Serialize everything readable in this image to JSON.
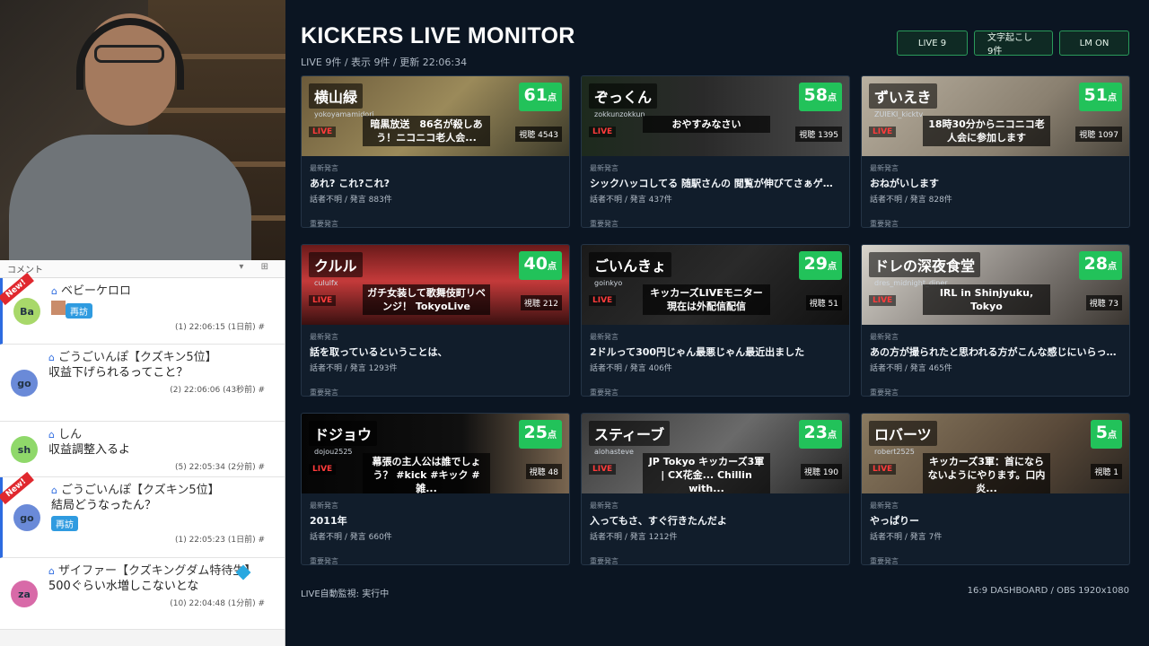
{
  "header": {
    "title": "KICKERS LIVE MONITOR",
    "subtitle": "LIVE 9件 / 表示 9件 / 更新 22:06:34",
    "buttons": {
      "live": "LIVE 9",
      "transcript": "文字起こし 9件",
      "lm": "LM ON"
    }
  },
  "labels": {
    "latest": "最新発言",
    "important": "重要発言",
    "live_badge": "LIVE",
    "score_unit": "点",
    "views_prefix": "視聴"
  },
  "cards": [
    {
      "name": "横山緑",
      "handle": "yokoyamamidori",
      "caption": "暗黒放送　86名が殺しあう！ニコニコ老人会...",
      "score": "61",
      "views": "4543",
      "latest": "あれ? これ?これ?",
      "stats": "話者不明 / 発言 883件"
    },
    {
      "name": "ぞっくん",
      "handle": "zokkunzokkun",
      "caption": "おやすみなさい",
      "score": "58",
      "views": "1395",
      "latest": "シックハッコしてる 随駅さんの 閲覧が伸びてさぁゲーム...",
      "stats": "話者不明 / 発言 437件"
    },
    {
      "name": "ずいえき",
      "handle": "ZUIEKI_kicktv",
      "caption": "18時30分からニコニコ老人会に参加します",
      "score": "51",
      "views": "1097",
      "latest": "おねがいします",
      "stats": "話者不明 / 発言 828件"
    },
    {
      "name": "クルル",
      "handle": "cululfx",
      "caption": "ガチ女装して歌舞伎町リベンジ！ TokyoLive",
      "score": "40",
      "views": "212",
      "latest": "話を取っているということは、",
      "stats": "話者不明 / 発言 1293件"
    },
    {
      "name": "ごいんきょ",
      "handle": "goinkyo",
      "caption": "キッカーズLIVEモニター 現在は外配信配信",
      "score": "29",
      "views": "51",
      "latest": "2ドルって300円じゃん最悪じゃん最近出ました",
      "stats": "話者不明 / 発言 406件"
    },
    {
      "name": "ドレの深夜食堂",
      "handle": "dres_midnight_diner",
      "caption": "IRL in Shinjyuku, Tokyo",
      "score": "28",
      "views": "73",
      "latest": "あの方が撮られたと思われる方がこんな感じにいらっし...",
      "stats": "話者不明 / 発言 465件"
    },
    {
      "name": "ドジョウ",
      "handle": "dojou2525",
      "caption": "幕張の主人公は誰でしょう？ #kick #キック #雑...",
      "score": "25",
      "views": "48",
      "latest": "2011年",
      "stats": "話者不明 / 発言 660件"
    },
    {
      "name": "スティーブ",
      "handle": "alohasteve",
      "caption": "JP Tokyo キッカーズ3軍 | CX花金... Chillin with...",
      "score": "23",
      "views": "190",
      "latest": "入ってもさ、すぐ行きたんだよ",
      "stats": "話者不明 / 発言 1212件"
    },
    {
      "name": "ロバーツ",
      "handle": "robert2525",
      "caption": "キッカーズ3軍：首にならないようにやります。口内炎...",
      "score": "5",
      "views": "1",
      "latest": "やっぱりー",
      "stats": "話者不明 / 発言 7件"
    }
  ],
  "footer": {
    "left": "LIVE自動監視: 実行中",
    "right": "16:9 DASHBOARD / OBS 1920x1080"
  },
  "chat": {
    "header": "コメント",
    "new_label": "New!",
    "revisit_label": "再訪",
    "items": [
      {
        "avatar": "Ba",
        "name": "ベビーケロロ",
        "msg": "",
        "meta": "(1)  22:06:15  (1日前)  #",
        "new": true,
        "revisit": true,
        "emote": true
      },
      {
        "avatar": "go",
        "name": "ごうごいんぽ【クズキン5位】",
        "msg": "収益下げられるってこと？",
        "meta": "(2)  22:06:06  (43秒前)  #",
        "new": false,
        "revisit": false,
        "emote": false
      },
      {
        "avatar": "sh",
        "name": "しん",
        "msg": "収益調整入るよ",
        "meta": "(5)  22:05:34  (2分前)  #",
        "new": false,
        "revisit": false,
        "emote": false
      },
      {
        "avatar": "go",
        "name": "ごうごいんぽ【クズキン5位】",
        "msg": "結局どうなったん？",
        "meta": "(1)  22:05:23  (1日前)  #",
        "new": true,
        "revisit": true,
        "emote": false
      },
      {
        "avatar": "za",
        "name": "ザイファー【クズキングダム特待生】",
        "msg": "500ぐらい水増しこないとな",
        "meta": "(10)  22:04:48  (1分前)  #",
        "new": false,
        "revisit": false,
        "emote": false
      }
    ]
  },
  "colors": {
    "accent_green": "#22c25a",
    "bg": "#0b1522",
    "card_bg": "#111d2b",
    "live_red": "#ff3b3b",
    "chat_blue": "#2d6be0"
  }
}
